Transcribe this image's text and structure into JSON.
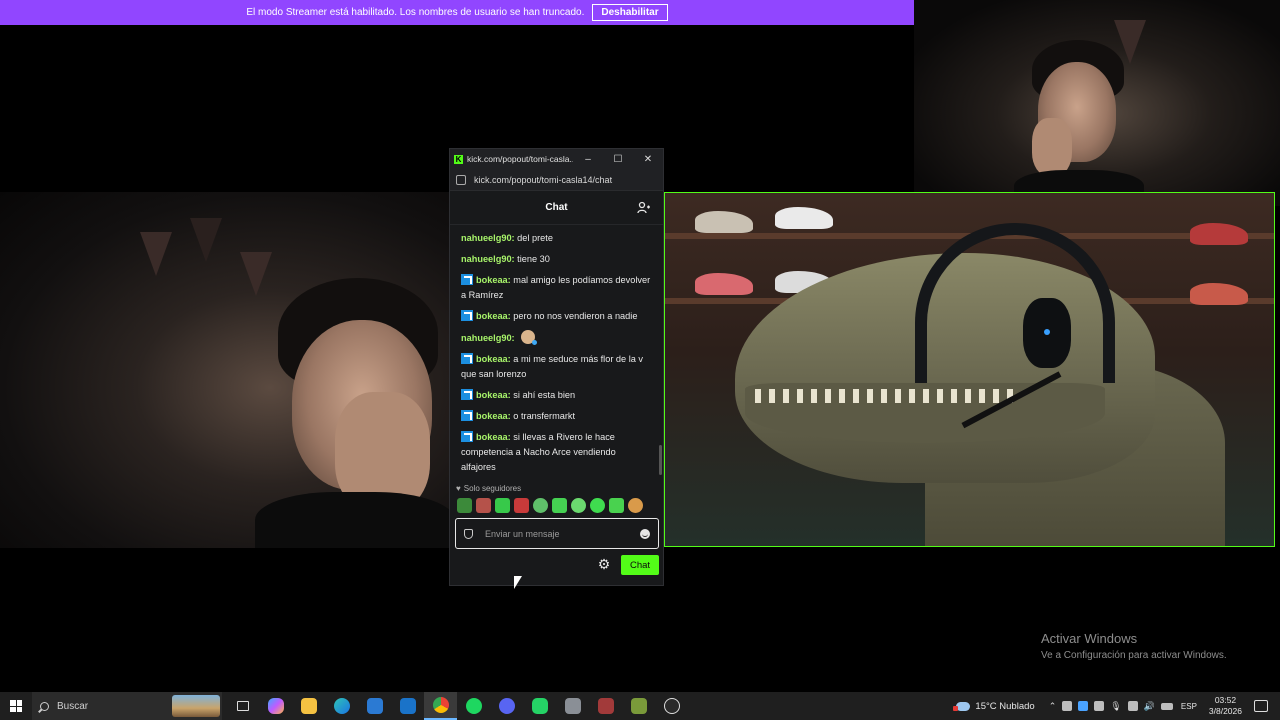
{
  "banner": {
    "message": "El modo Streamer está habilitado. Los nombres de usuario se han truncado.",
    "button_label": "Deshabilitar",
    "color": "#9146ff"
  },
  "popout": {
    "window_title": "kick.com/popout/tomi-casla...",
    "url": "kick.com/popout/tomi-casla14/chat",
    "chat_title": "Chat",
    "messages": [
      {
        "user": "nahueelg90:",
        "text": "del prete",
        "badge": false
      },
      {
        "user": "nahueelg90:",
        "text": "tiene 30",
        "badge": false
      },
      {
        "user": "bokeaa:",
        "text": "mal amigo les podíamos devolver a Ramírez",
        "badge": true
      },
      {
        "user": "bokeaa:",
        "text": "pero no nos vendieron a nadie",
        "badge": true
      },
      {
        "user": "nahueelg90:",
        "text": "",
        "badge": false,
        "emote": "emote-icon"
      },
      {
        "user": "bokeaa:",
        "text": "a mi me seduce más flor de la v que san lorenzo",
        "badge": true
      },
      {
        "user": "bokeaa:",
        "text": "si ahí esta bien",
        "badge": true
      },
      {
        "user": "bokeaa:",
        "text": "o transfermarkt",
        "badge": true
      },
      {
        "user": "bokeaa:",
        "text": "si llevas a Rivero le hace competencia a Nacho Arce vendiendo alfajores",
        "badge": true
      }
    ],
    "followers_only": "Solo seguidores",
    "input_placeholder": "Enviar un mensaje",
    "send_label": "Chat",
    "accent": "#53fc18"
  },
  "watermark": {
    "title": "Activar Windows",
    "subtitle": "Ve a Configuración para activar Windows."
  },
  "taskbar": {
    "search_placeholder": "Buscar",
    "apps": [
      "task-view-icon",
      "copilot-icon",
      "file-explorer-icon",
      "edge-icon",
      "store-icon",
      "outlook-icon",
      "chrome-icon",
      "spotify-icon",
      "discord-icon",
      "whatsapp-icon",
      "app-icon",
      "game-icon",
      "minecraft-icon",
      "obs-icon"
    ],
    "weather": "15°C  Nublado",
    "language": "ESP",
    "time": "03:52",
    "date": "3/8/2026"
  }
}
